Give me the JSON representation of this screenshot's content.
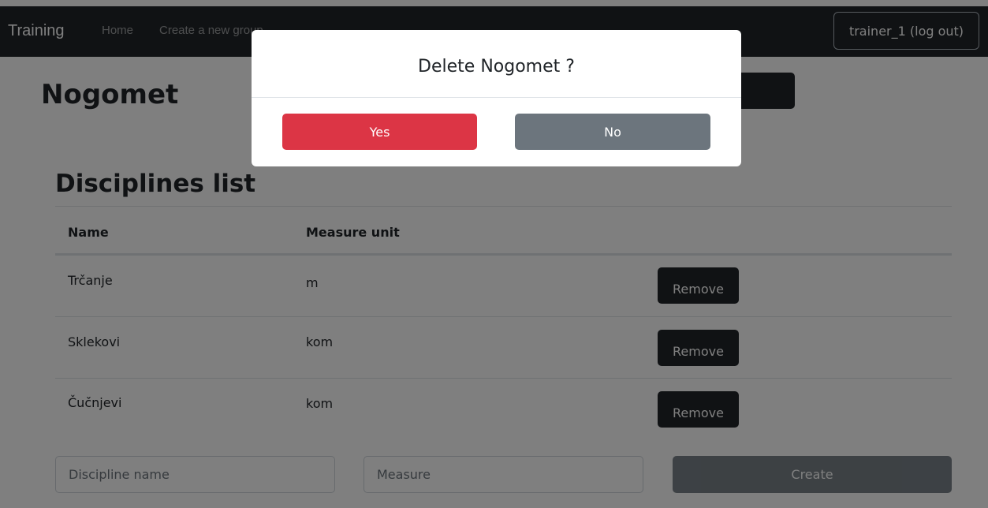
{
  "navbar": {
    "brand": "Training",
    "links": [
      "Home",
      "Create a new group"
    ],
    "user_button": "trainer_1 (log out)"
  },
  "page": {
    "group_title": "Nogomet",
    "section_title": "Disciplines list"
  },
  "table": {
    "headers": [
      "Name",
      "Measure unit"
    ],
    "rows": [
      {
        "name": "Trčanje",
        "unit": "m",
        "action": "Remove"
      },
      {
        "name": "Sklekovi",
        "unit": "kom",
        "action": "Remove"
      },
      {
        "name": "Čučnjevi",
        "unit": "kom",
        "action": "Remove"
      }
    ]
  },
  "form": {
    "discipline_placeholder": "Discipline name",
    "measure_placeholder": "Measure",
    "create_label": "Create"
  },
  "modal": {
    "title": "Delete Nogomet ?",
    "yes_label": "Yes",
    "no_label": "No"
  },
  "colors": {
    "navbar": "#212529",
    "danger": "#dc3545",
    "secondary": "#6c757d",
    "backdrop": "rgba(0,0,0,0.5)"
  }
}
